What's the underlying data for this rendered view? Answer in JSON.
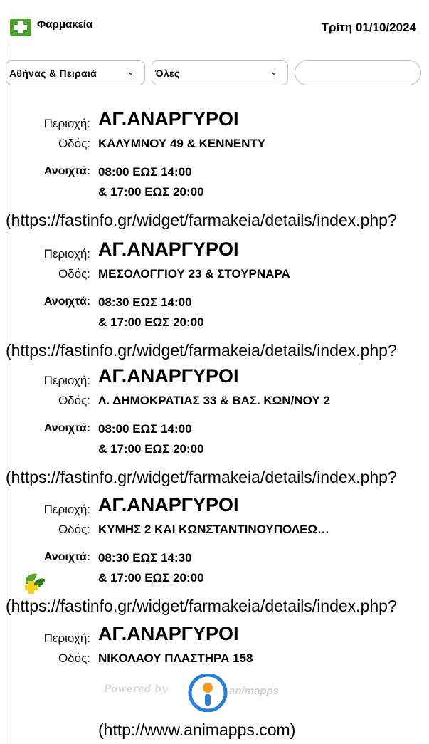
{
  "header": {
    "app_title": "Φαρμακεία",
    "date": "Τρίτη 01/10/2024"
  },
  "filters": {
    "region_selected": "Αθήνας & Πειραιά",
    "town_selected": "Όλες",
    "search_value": "",
    "search_placeholder": ""
  },
  "labels": {
    "region": "Περιοχή:",
    "street": "Οδός:",
    "open": "Ανοιχτά:"
  },
  "pharmacies": [
    {
      "region": "ΑΓ.ΑΝΑΡΓΥΡΟΙ",
      "street": "ΚΑΛΥΜΝΟΥ 49 & ΚΕΝΝΕΝΤΥ",
      "hours1": "08:00 ΕΩΣ 14:00",
      "hours2": "& 17:00 ΕΩΣ 20:00",
      "link": "(https://fastinfo.gr/widget/farmakeia/details/index.php?"
    },
    {
      "region": "ΑΓ.ΑΝΑΡΓΥΡΟΙ",
      "street": "ΜΕΣΟΛΟΓΓΙΟΥ 23 & ΣΤΟΥΡΝΑΡΑ",
      "hours1": "08:30 ΕΩΣ 14:00",
      "hours2": "& 17:00 ΕΩΣ 20:00",
      "link": "(https://fastinfo.gr/widget/farmakeia/details/index.php?"
    },
    {
      "region": "ΑΓ.ΑΝΑΡΓΥΡΟΙ",
      "street": "Λ. ΔΗΜΟΚΡΑΤΙΑΣ 33 & ΒΑΣ. ΚΩΝ/ΝΟΥ 2",
      "hours1": "08:00 ΕΩΣ 14:00",
      "hours2": "& 17:00 ΕΩΣ 20:00",
      "link": "(https://fastinfo.gr/widget/farmakeia/details/index.php?"
    },
    {
      "region": "ΑΓ.ΑΝΑΡΓΥΡΟΙ",
      "street": "ΚΥΜΗΣ 2 ΚΑΙ ΚΩΝΣΤΑΝΤΙΝΟΥΠΟΛΕΩ…",
      "hours1": "08:30 ΕΩΣ 14:30",
      "hours2": "& 17:00 ΕΩΣ 20:00",
      "link": "(https://fastinfo.gr/widget/farmakeia/details/index.php?"
    },
    {
      "region": "ΑΓ.ΑΝΑΡΓΥΡΟΙ",
      "street": "ΝΙΚΟΛΑΟΥ ΠΛΑΣΤΗΡΑ 158"
    }
  ],
  "footer": {
    "powered_by": "Powered by",
    "brand": "animapps",
    "link": "(http://www.animapps.com)"
  },
  "colors": {
    "logo_green": "#4ca02f",
    "footer_logo_blue": "#2a7fd4",
    "footer_logo_orange": "#f39a1e"
  },
  "icons": {
    "logo": "green-cross-icon",
    "select_chevron": "chevron-down-icon",
    "leaf_plus": "pharmacy-leaf-icon"
  }
}
